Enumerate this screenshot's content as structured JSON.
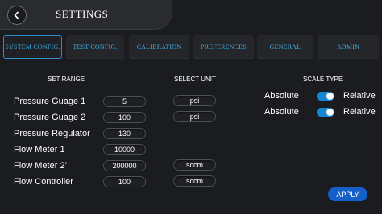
{
  "header": {
    "title": "SETTINGS",
    "back_icon": "chevron-left-icon"
  },
  "tabs": [
    {
      "label": "SYSTEM CONFIG.",
      "active": true
    },
    {
      "label": "TEST CONFIG.",
      "active": false
    },
    {
      "label": "CALIBRATION",
      "active": false
    },
    {
      "label": "PREFERENCES",
      "active": false
    },
    {
      "label": "GENERAL",
      "active": false
    },
    {
      "label": "ADMIN",
      "active": false
    }
  ],
  "columns": {
    "range": "SET RANGE",
    "unit": "SELECT UNIT",
    "scale": "SCALE TYPE"
  },
  "rows": [
    {
      "label": "Pressure Guage 1",
      "value": "5",
      "unit": "psi"
    },
    {
      "label": "Pressure Guage 2",
      "value": "100",
      "unit": "psi"
    },
    {
      "label": "Pressure Regulator",
      "value": "130"
    },
    {
      "label": "Flow Meter 1",
      "value": "10000"
    },
    {
      "label": "Flow Meter 2’",
      "value": "200000",
      "unit": "sccm"
    },
    {
      "label": "Flow Controller",
      "value": "100",
      "unit": "sccm"
    }
  ],
  "scale_toggles": [
    {
      "left": "Absolute",
      "right": "Relative",
      "on": true
    },
    {
      "left": "Absolute",
      "right": "Relative",
      "on": true
    }
  ],
  "apply_label": "APPLY",
  "colors": {
    "accent": "#3ab3ef",
    "toggle": "#1587d3",
    "apply": "#1560c8",
    "background": "#1b1c1f"
  }
}
